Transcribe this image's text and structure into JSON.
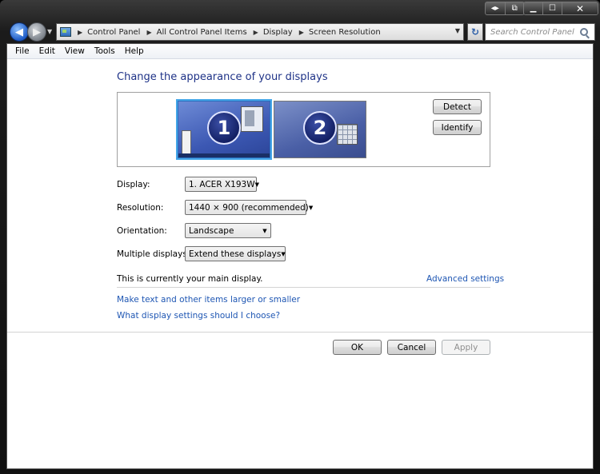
{
  "nav": {
    "breadcrumbs": [
      "Control Panel",
      "All Control Panel Items",
      "Display",
      "Screen Resolution"
    ],
    "search_placeholder": "Search Control Panel"
  },
  "menu": [
    "File",
    "Edit",
    "View",
    "Tools",
    "Help"
  ],
  "heading": "Change the appearance of your displays",
  "monitors": [
    {
      "number": "1",
      "selected": true
    },
    {
      "number": "2",
      "selected": false
    }
  ],
  "buttons": {
    "detect": "Detect",
    "identify": "Identify",
    "ok": "OK",
    "cancel": "Cancel",
    "apply": "Apply"
  },
  "settings": {
    "display_label": "Display:",
    "display_value": "1. ACER X193W",
    "resolution_label": "Resolution:",
    "resolution_value": "1440 × 900 (recommended)",
    "orientation_label": "Orientation:",
    "orientation_value": "Landscape",
    "multiple_label": "Multiple displays:",
    "multiple_value": "Extend these displays"
  },
  "info_text": "This is currently your main display.",
  "advanced_link": "Advanced settings",
  "links": [
    "Make text and other items larger or smaller",
    "What display settings should I choose?"
  ],
  "colors": {
    "heading": "#1e3287",
    "link": "#1e56b3",
    "selected_outline": "#44a6e8"
  }
}
